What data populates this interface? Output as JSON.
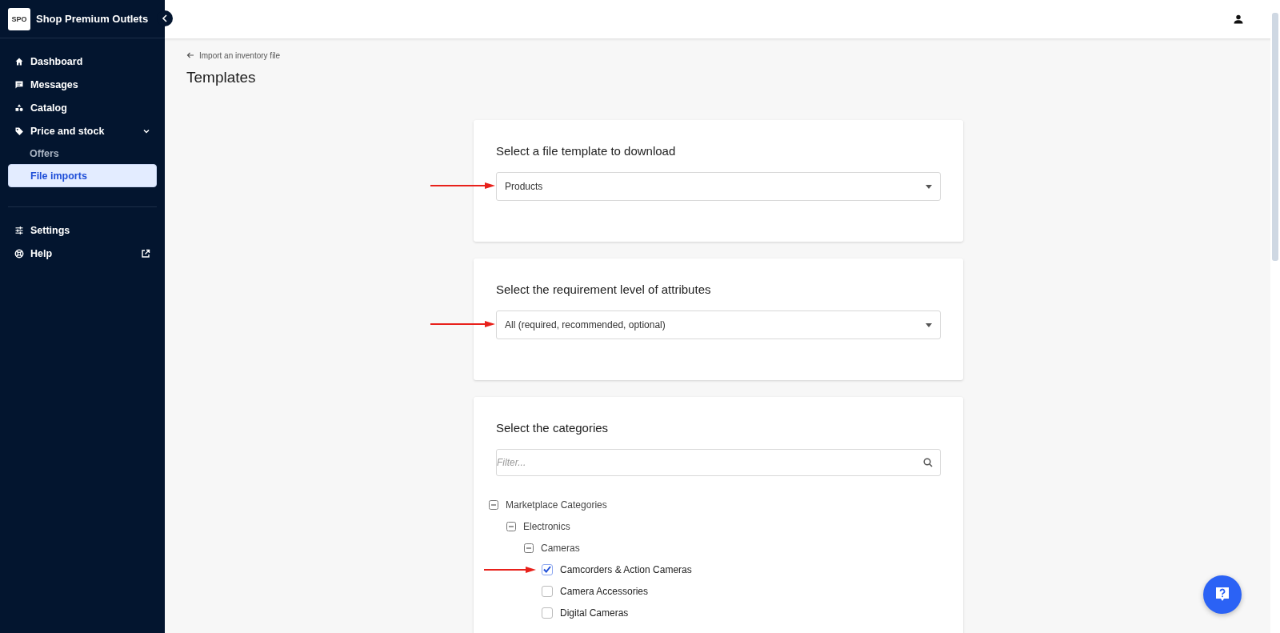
{
  "sidebar": {
    "logo_text": "SPO",
    "shop_name": "Shop Premium Outlets",
    "nav": [
      {
        "label": "Dashboard",
        "selected": false
      },
      {
        "label": "Messages",
        "selected": false
      },
      {
        "label": "Catalog",
        "selected": false
      },
      {
        "label": "Price and stock",
        "selected": false,
        "expanded": true,
        "children": [
          {
            "label": "Offers",
            "selected": false
          },
          {
            "label": "File imports",
            "selected": true
          }
        ]
      }
    ],
    "nav_bottom": [
      {
        "label": "Settings",
        "selected": false,
        "external": false
      },
      {
        "label": "Help",
        "selected": false,
        "external": true
      }
    ]
  },
  "page": {
    "back_link": "Import an inventory file",
    "title": "Templates"
  },
  "cards": [
    {
      "kind": "select",
      "title": "Select a file template to download",
      "value": "Products",
      "arrow": true
    },
    {
      "kind": "select",
      "title": "Select the requirement level of attributes",
      "value": "All (required, recommended, optional)",
      "arrow": true
    },
    {
      "kind": "tree",
      "title": "Select the categories",
      "placeholder": "Filter...",
      "tree": [
        {
          "label": "Marketplace Categories",
          "expanded": true,
          "children": [
            {
              "label": "Electronics",
              "expanded": true,
              "children": [
                {
                  "label": "Cameras",
                  "expanded": true,
                  "children": [
                    {
                      "label": "Camcorders & Action Cameras",
                      "checked": true,
                      "arrow": true
                    },
                    {
                      "label": "Camera Accessories",
                      "checked": false,
                      "arrow": false
                    },
                    {
                      "label": "Digital Cameras",
                      "checked": false,
                      "arrow": false
                    }
                  ]
                }
              ]
            }
          ]
        }
      ]
    }
  ]
}
